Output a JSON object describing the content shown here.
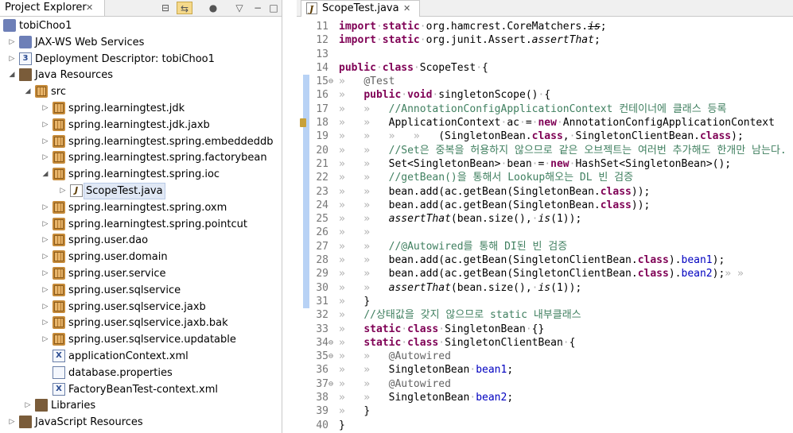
{
  "explorer": {
    "tab_label": "Project Explorer",
    "close": "✕",
    "toolbar": [
      "⊟",
      "⇆",
      "●",
      "▽",
      "−",
      "□"
    ],
    "items": [
      {
        "label": "tobiChoo1",
        "depth": 0,
        "toggle": "",
        "icon": "project"
      },
      {
        "label": "JAX-WS Web Services",
        "depth": 1,
        "toggle": "▷",
        "icon": "ws"
      },
      {
        "label": "Deployment Descriptor: tobiChoo1",
        "depth": 1,
        "toggle": "▷",
        "icon": "dd"
      },
      {
        "label": "Java Resources",
        "depth": 1,
        "toggle": "◢",
        "icon": "jr"
      },
      {
        "label": "src",
        "depth": 2,
        "toggle": "◢",
        "icon": "src"
      },
      {
        "label": "spring.learningtest.jdk",
        "depth": 3,
        "toggle": "▷",
        "icon": "pkg"
      },
      {
        "label": "spring.learningtest.jdk.jaxb",
        "depth": 3,
        "toggle": "▷",
        "icon": "pkg"
      },
      {
        "label": "spring.learningtest.spring.embeddeddb",
        "depth": 3,
        "toggle": "▷",
        "icon": "pkg"
      },
      {
        "label": "spring.learningtest.spring.factorybean",
        "depth": 3,
        "toggle": "▷",
        "icon": "pkg"
      },
      {
        "label": "spring.learningtest.spring.ioc",
        "depth": 3,
        "toggle": "◢",
        "icon": "pkg"
      },
      {
        "label": "ScopeTest.java",
        "depth": 4,
        "toggle": "▷",
        "icon": "java",
        "selected": true
      },
      {
        "label": "spring.learningtest.spring.oxm",
        "depth": 3,
        "toggle": "▷",
        "icon": "pkg"
      },
      {
        "label": "spring.learningtest.spring.pointcut",
        "depth": 3,
        "toggle": "▷",
        "icon": "pkg"
      },
      {
        "label": "spring.user.dao",
        "depth": 3,
        "toggle": "▷",
        "icon": "pkg"
      },
      {
        "label": "spring.user.domain",
        "depth": 3,
        "toggle": "▷",
        "icon": "pkg"
      },
      {
        "label": "spring.user.service",
        "depth": 3,
        "toggle": "▷",
        "icon": "pkg"
      },
      {
        "label": "spring.user.sqlservice",
        "depth": 3,
        "toggle": "▷",
        "icon": "pkg"
      },
      {
        "label": "spring.user.sqlservice.jaxb",
        "depth": 3,
        "toggle": "▷",
        "icon": "pkg"
      },
      {
        "label": "spring.user.sqlservice.jaxb.bak",
        "depth": 3,
        "toggle": "▷",
        "icon": "pkg"
      },
      {
        "label": "spring.user.sqlservice.updatable",
        "depth": 3,
        "toggle": "▷",
        "icon": "pkg"
      },
      {
        "label": "applicationContext.xml",
        "depth": 3,
        "toggle": "",
        "icon": "xml"
      },
      {
        "label": "database.properties",
        "depth": 3,
        "toggle": "",
        "icon": "file"
      },
      {
        "label": "FactoryBeanTest-context.xml",
        "depth": 3,
        "toggle": "",
        "icon": "xml"
      },
      {
        "label": "Libraries",
        "depth": 2,
        "toggle": "▷",
        "icon": "lib"
      },
      {
        "label": "JavaScript Resources",
        "depth": 1,
        "toggle": "▷",
        "icon": "lib"
      }
    ]
  },
  "editor": {
    "tab_label": "ScopeTest.java",
    "close": "✕",
    "lines": [
      {
        "no": "11",
        "fold": "",
        "mark": false,
        "hl": false,
        "html": "<span class='kw'>import</span><span class='ws'>·</span><span class='kw'>static</span><span class='ws'>·</span>org.hamcrest.CoreMatchers.<span class='st'>is</span>;"
      },
      {
        "no": "12",
        "fold": "",
        "mark": false,
        "hl": false,
        "html": "<span class='kw'>import</span><span class='ws'>·</span><span class='kw'>static</span><span class='ws'>·</span>org.junit.Assert.<span class='it'>assertThat</span>;"
      },
      {
        "no": "13",
        "fold": "",
        "mark": false,
        "hl": false,
        "html": ""
      },
      {
        "no": "14",
        "fold": "",
        "mark": false,
        "hl": false,
        "html": "<span class='kw'>public</span><span class='ws'>·</span><span class='kw'>class</span><span class='ws'>·</span>ScopeTest<span class='ws'>·</span>{"
      },
      {
        "no": "15",
        "fold": "⊖",
        "mark": false,
        "hl": true,
        "html": "<span class='ws'>»   </span><span class='an'>@Test</span>"
      },
      {
        "no": "16",
        "fold": "",
        "mark": false,
        "hl": true,
        "html": "<span class='ws'>»   </span><span class='kw'>public</span><span class='ws'>·</span><span class='kw'>void</span><span class='ws'>·</span>singletonScope()<span class='ws'>·</span>{"
      },
      {
        "no": "17",
        "fold": "",
        "mark": false,
        "hl": true,
        "html": "<span class='ws'>»   »   </span><span class='cm'>//AnnotationConfigApplicationContext 컨테이너에 클래스 등록</span>"
      },
      {
        "no": "18",
        "fold": "",
        "mark": true,
        "hl": true,
        "html": "<span class='ws'>»   »   </span>ApplicationContext<span class='ws'>·</span>ac<span class='ws'>·</span>=<span class='ws'>·</span><span class='kw'>new</span><span class='ws'>·</span>AnnotationConfigApplicationContext"
      },
      {
        "no": "19",
        "fold": "",
        "mark": false,
        "hl": true,
        "html": "<span class='ws'>»   »   »   »   </span>(SingletonBean.<span class='kw'>class</span>,<span class='ws'>·</span>SingletonClientBean.<span class='kw'>class</span>);"
      },
      {
        "no": "20",
        "fold": "",
        "mark": false,
        "hl": true,
        "html": "<span class='ws'>»   »   </span><span class='cm'>//Set은 중복을 허용하지 않으므로 같은 오브젝트는 여러번 추가해도 한개만 남는다.</span>"
      },
      {
        "no": "21",
        "fold": "",
        "mark": false,
        "hl": true,
        "html": "<span class='ws'>»   »   </span>Set&lt;SingletonBean&gt;<span class='ws'>·</span>bean<span class='ws'>·</span>=<span class='ws'>·</span><span class='kw'>new</span><span class='ws'>·</span>HashSet&lt;SingletonBean&gt;();"
      },
      {
        "no": "22",
        "fold": "",
        "mark": false,
        "hl": true,
        "html": "<span class='ws'>»   »   </span><span class='cm'>//getBean()을 통해서 Lookup해오는 DL 빈 검증</span>"
      },
      {
        "no": "23",
        "fold": "",
        "mark": false,
        "hl": true,
        "html": "<span class='ws'>»   »   </span>bean.add(ac.getBean(SingletonBean.<span class='kw'>class</span>));"
      },
      {
        "no": "24",
        "fold": "",
        "mark": false,
        "hl": true,
        "html": "<span class='ws'>»   »   </span>bean.add(ac.getBean(SingletonBean.<span class='kw'>class</span>));"
      },
      {
        "no": "25",
        "fold": "",
        "mark": false,
        "hl": true,
        "html": "<span class='ws'>»   »   </span><span class='it'>assertThat</span>(bean.size(),<span class='ws'>·</span><span class='it'>is</span>(1));"
      },
      {
        "no": "26",
        "fold": "",
        "mark": false,
        "hl": true,
        "html": "<span class='ws'>»   »   </span>"
      },
      {
        "no": "27",
        "fold": "",
        "mark": false,
        "hl": true,
        "html": "<span class='ws'>»   »   </span><span class='cm'>//@Autowired를 통해 DI된 빈 검증</span>"
      },
      {
        "no": "28",
        "fold": "",
        "mark": false,
        "hl": true,
        "html": "<span class='ws'>»   »   </span>bean.add(ac.getBean(SingletonClientBean.<span class='kw'>class</span>).<span class='fd'>bean1</span>);"
      },
      {
        "no": "29",
        "fold": "",
        "mark": false,
        "hl": true,
        "html": "<span class='ws'>»   »   </span>bean.add(ac.getBean(SingletonClientBean.<span class='kw'>class</span>).<span class='fd'>bean2</span>);<span class='ws'>» »</span>"
      },
      {
        "no": "30",
        "fold": "",
        "mark": false,
        "hl": true,
        "html": "<span class='ws'>»   »   </span><span class='it'>assertThat</span>(bean.size(),<span class='ws'>·</span><span class='it'>is</span>(1));"
      },
      {
        "no": "31",
        "fold": "",
        "mark": false,
        "hl": true,
        "html": "<span class='ws'>»   </span>}"
      },
      {
        "no": "32",
        "fold": "",
        "mark": false,
        "hl": false,
        "html": "<span class='ws'>»   </span><span class='cm'>//상태값을 갖지 않으므로 static 내부클래스</span>"
      },
      {
        "no": "33",
        "fold": "",
        "mark": false,
        "hl": false,
        "html": "<span class='ws'>»   </span><span class='kw'>static</span><span class='ws'>·</span><span class='kw'>class</span><span class='ws'>·</span>SingletonBean<span class='ws'>·</span>{}"
      },
      {
        "no": "34",
        "fold": "⊖",
        "mark": false,
        "hl": false,
        "html": "<span class='ws'>»   </span><span class='kw'>static</span><span class='ws'>·</span><span class='kw'>class</span><span class='ws'>·</span>SingletonClientBean<span class='ws'>·</span>{"
      },
      {
        "no": "35",
        "fold": "⊖",
        "mark": false,
        "hl": false,
        "html": "<span class='ws'>»   »   </span><span class='an'>@Autowired</span>"
      },
      {
        "no": "36",
        "fold": "",
        "mark": false,
        "hl": false,
        "html": "<span class='ws'>»   »   </span>SingletonBean<span class='ws'>·</span><span class='fd'>bean1</span>;"
      },
      {
        "no": "37",
        "fold": "⊖",
        "mark": false,
        "hl": false,
        "html": "<span class='ws'>»   »   </span><span class='an'>@Autowired</span>"
      },
      {
        "no": "38",
        "fold": "",
        "mark": false,
        "hl": false,
        "html": "<span class='ws'>»   »   </span>SingletonBean<span class='ws'>·</span><span class='fd'>bean2</span>;"
      },
      {
        "no": "39",
        "fold": "",
        "mark": false,
        "hl": false,
        "html": "<span class='ws'>»   </span>}"
      },
      {
        "no": "40",
        "fold": "",
        "mark": false,
        "hl": false,
        "html": "}"
      }
    ]
  }
}
